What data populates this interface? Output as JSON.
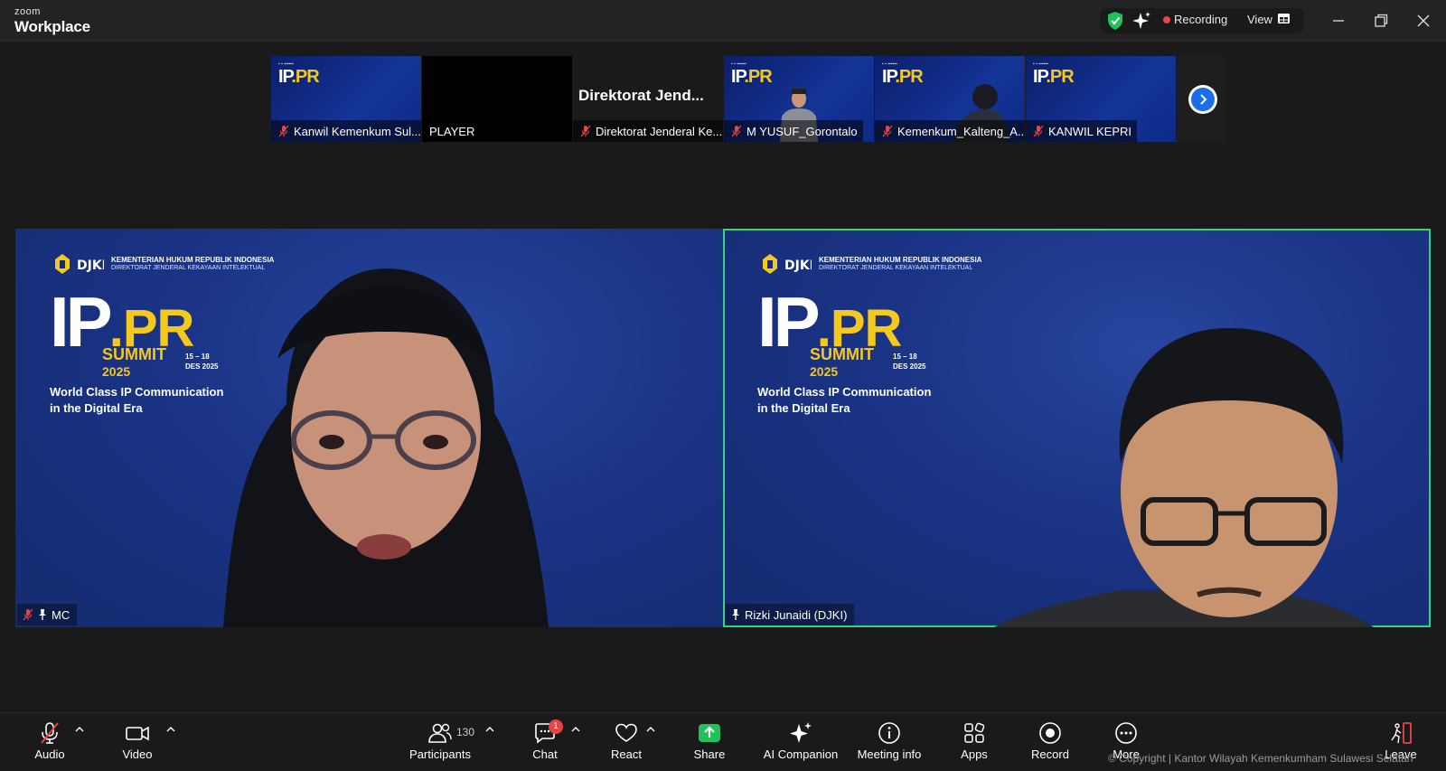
{
  "app": {
    "brand_top": "zoom",
    "brand_bottom": "Workplace"
  },
  "titlebar": {
    "recording_label": "Recording",
    "view_label": "View"
  },
  "thumbnails": [
    {
      "name": "Kanwil Kemenkum Sul...",
      "muted": true,
      "background": "slide"
    },
    {
      "name": "PLAYER",
      "muted": false,
      "background": "black"
    },
    {
      "name": "Direktorat Jenderal Ke...",
      "muted": true,
      "background": "name",
      "display_name": "Direktorat  Jend..."
    },
    {
      "name": "M YUSUF_Gorontalo",
      "muted": true,
      "background": "slide"
    },
    {
      "name": "Kemenkum_Kalteng_A...",
      "muted": true,
      "background": "slide"
    },
    {
      "name": "KANWIL KEPRI",
      "muted": true,
      "background": "slide"
    }
  ],
  "tiles": {
    "left": {
      "name": "MC",
      "muted": true,
      "pinned": true,
      "slide": {
        "brand1": "KEMENTERIAN HUKUM REPUBLIK INDONESIA",
        "brand2": "DIREKTORAT JENDERAL KEKAYAAN INTELEKTUAL",
        "ip": "IP",
        "pr": ".PR",
        "summit": "SUMMIT",
        "year": "2025",
        "dates_1": "15 – 18",
        "dates_2": "DES 2025",
        "tagline_1": "World Class IP Communication",
        "tagline_2": "in the Digital Era"
      }
    },
    "right": {
      "name": "Rizki Junaidi (DJKI)",
      "muted": false,
      "pinned": true,
      "active_speaker": true,
      "slide": {
        "brand1": "KEMENTERIAN HUKUM REPUBLIK INDONESIA",
        "brand2": "DIREKTORAT JENDERAL KEKAYAAN INTELEKTUAL",
        "ip": "IP",
        "pr": ".PR",
        "summit": "SUMMIT",
        "year": "2025",
        "dates_1": "15 – 18",
        "dates_2": "DES 2025",
        "tagline_1": "World Class IP Communication",
        "tagline_2": "in the Digital Era"
      }
    }
  },
  "toolbar": {
    "audio": "Audio",
    "video": "Video",
    "participants": "Participants",
    "participants_count": "130",
    "chat": "Chat",
    "chat_badge": "1",
    "react": "React",
    "share": "Share",
    "ai_companion": "AI Companion",
    "meeting_info": "Meeting info",
    "apps": "Apps",
    "record": "Record",
    "more": "More",
    "leave": "Leave"
  },
  "watermark": "© Copyright | Kantor Wilayah Kemenkumham Sulawesi Selatan",
  "colors": {
    "active_speaker_border": "#2bd682",
    "share_green": "#21c05a",
    "slide_blue": "#1a3384",
    "accent_yellow": "#f4c81c",
    "mute_red": "#e64545"
  }
}
